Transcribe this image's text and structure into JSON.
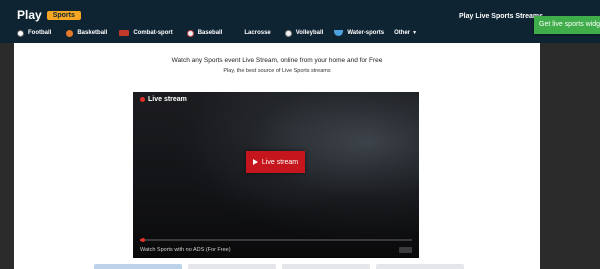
{
  "header": {
    "logo_text": "Play",
    "logo_badge": "Sports",
    "right_title": "Play Live Sports Streams",
    "widget_button": "Get live sports widget"
  },
  "nav": {
    "items": [
      {
        "label": "Football",
        "icon": "football-icon"
      },
      {
        "label": "Basketball",
        "icon": "basketball-icon"
      },
      {
        "label": "Combat-sport",
        "icon": "combat-sport-icon"
      },
      {
        "label": "Baseball",
        "icon": "baseball-icon"
      },
      {
        "label": "Lacrosse",
        "icon": "lacrosse-icon"
      },
      {
        "label": "Volleyball",
        "icon": "volleyball-icon"
      },
      {
        "label": "Water-sports",
        "icon": "water-sports-icon"
      }
    ],
    "other_label": "Other"
  },
  "intro": {
    "line1": "Watch any Sports event Live Stream, online from your home and for Free",
    "line2": "Play, the best source of Live Sports streams"
  },
  "player": {
    "live_label": "Live stream",
    "play_button": "Live stream",
    "caption": "Watch Sports with no ADS (For Free)",
    "progress": 0.01
  },
  "colors": {
    "header_bg": "#0f2433",
    "badge": "#f5a623",
    "widget_green": "#3fae4a",
    "live_red": "#c4161c"
  },
  "tabs_count": 4
}
